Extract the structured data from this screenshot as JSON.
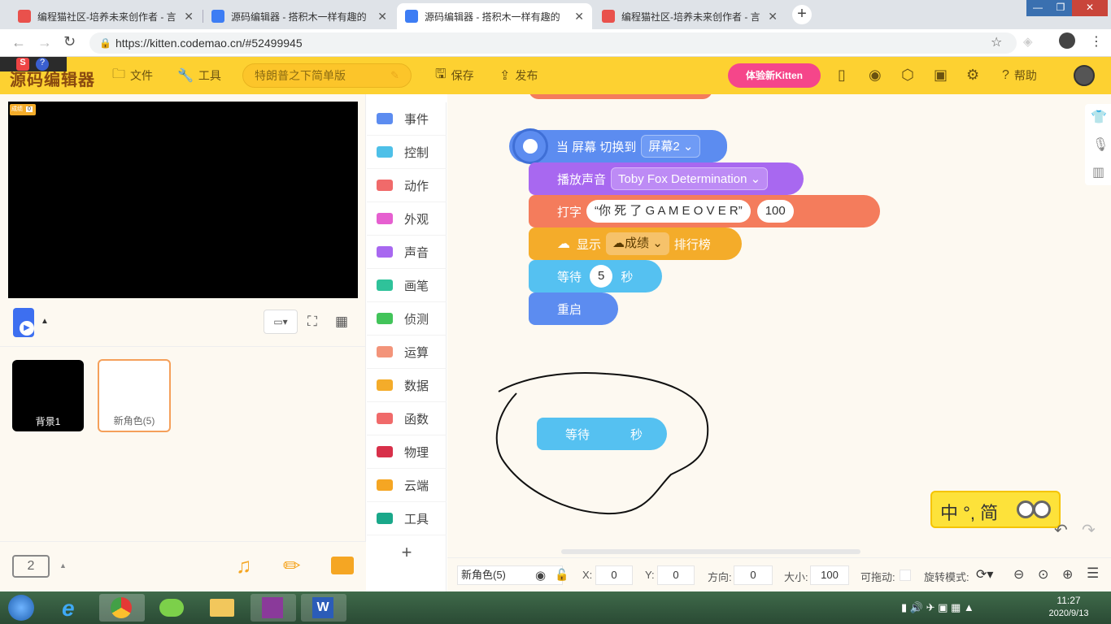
{
  "browser": {
    "tabs": [
      {
        "title": "编程猫社区-培养未来创作者 - 言",
        "active": false
      },
      {
        "title": "源码编辑器 - 搭积木一样有趣的",
        "active": false
      },
      {
        "title": "源码编辑器 - 搭积木一样有趣的",
        "active": true
      },
      {
        "title": "编程猫社区-培养未来创作者 - 言",
        "active": false
      }
    ],
    "new_tab": "+",
    "url": "https://kitten.codemao.cn/#52499945",
    "window_buttons": [
      "—",
      "❐",
      "✕"
    ]
  },
  "app": {
    "logo": "源码编辑器",
    "menu_file": "文件",
    "menu_tools": "工具",
    "project_name": "特朗普之下简单版",
    "save": "保存",
    "publish": "发布",
    "try_kitten": "体验新Kitten",
    "help": "帮助"
  },
  "stage": {
    "var_label": "成绩",
    "var_value": "0"
  },
  "sprites": [
    {
      "name": "背景1",
      "selected": false
    },
    {
      "name": "新角色(5)",
      "selected": true
    }
  ],
  "screen_count": "2",
  "categories": [
    {
      "label": "事件",
      "color": "#5c8cf0"
    },
    {
      "label": "控制",
      "color": "#4ec0e8"
    },
    {
      "label": "动作",
      "color": "#f06a6a"
    },
    {
      "label": "外观",
      "color": "#e65fd0"
    },
    {
      "label": "声音",
      "color": "#a868f0"
    },
    {
      "label": "画笔",
      "color": "#2fc29a"
    },
    {
      "label": "侦测",
      "color": "#42c45a"
    },
    {
      "label": "运算",
      "color": "#f3947a"
    },
    {
      "label": "数据",
      "color": "#f4ac2a"
    },
    {
      "label": "函数",
      "color": "#f06a6a"
    },
    {
      "label": "物理",
      "color": "#d8304a"
    },
    {
      "label": "云端",
      "color": "#f5a623"
    },
    {
      "label": "工具",
      "color": "#1aa88a"
    }
  ],
  "add_extension": "+",
  "blocks": {
    "hat_text": "当 屏幕 切换到",
    "hat_dropdown": "屏幕2",
    "sound_text": "播放声音",
    "sound_dropdown": "Toby Fox  Determination",
    "type_text": "打字",
    "type_string": "“你 死 了 G A M E   O V E R”",
    "type_speed": "100",
    "show_text": "显示",
    "show_dropdown": "成绩",
    "show_suffix": "排行榜",
    "wait_text": "等待",
    "wait_value": "5",
    "wait_unit": "秒",
    "restart_text": "重启",
    "loose_wait_text": "等待",
    "loose_wait_unit": "秒"
  },
  "props": {
    "sprite_name": "新角色(5)",
    "x_label": "X:",
    "x_value": "0",
    "y_label": "Y:",
    "y_value": "0",
    "dir_label": "方向:",
    "dir_value": "0",
    "size_label": "大小:",
    "size_value": "100",
    "drag_label": "可拖动:",
    "rot_label": "旋转模式:"
  },
  "ime": {
    "text": "中 °, 简"
  },
  "clock": {
    "time": "11:27",
    "date": "2020/9/13"
  },
  "colors": {
    "header": "#fdd131",
    "event": "#5c8cf0",
    "sound": "#a868f0",
    "action": "#f47c5c",
    "data": "#f4ac2a",
    "control": "#55c1f1"
  }
}
